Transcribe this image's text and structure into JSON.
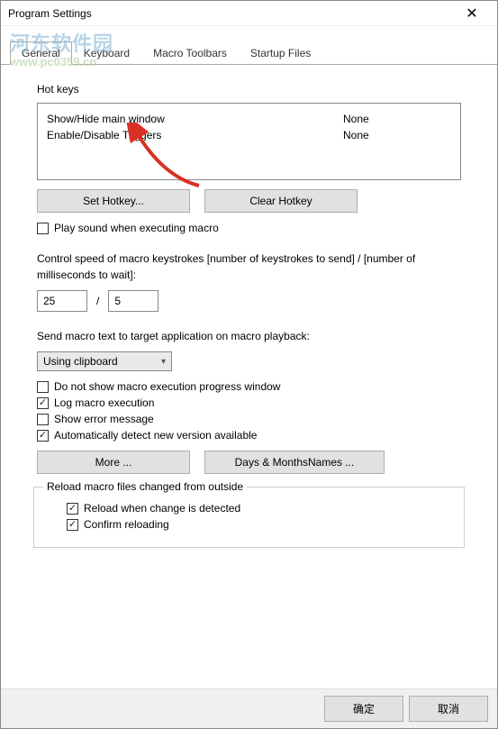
{
  "window": {
    "title": "Program Settings"
  },
  "watermark": {
    "main": "河东软件园",
    "sub": "www.pc0359.cn"
  },
  "tabs": [
    {
      "label": "General",
      "active": true
    },
    {
      "label": "Keyboard",
      "active": false
    },
    {
      "label": "Macro Toolbars",
      "active": false
    },
    {
      "label": "Startup Files",
      "active": false
    }
  ],
  "hotkeys": {
    "heading": "Hot keys",
    "rows": [
      {
        "name": "Show/Hide main window",
        "value": "None"
      },
      {
        "name": "Enable/Disable Triggers",
        "value": "None"
      }
    ],
    "set_btn": "Set Hotkey...",
    "clear_btn": "Clear Hotkey"
  },
  "play_sound": {
    "label": "Play sound when executing macro",
    "checked": false
  },
  "speed": {
    "description": "Control speed of macro keystrokes [number of keystrokes to send] / [number of milliseconds to wait]:",
    "keystrokes": "25",
    "sep": "/",
    "millis": "5"
  },
  "send_text": {
    "description": "Send macro text to target application on macro playback:",
    "selected": "Using clipboard"
  },
  "options": [
    {
      "label": "Do not show macro execution progress window",
      "checked": false
    },
    {
      "label": "Log macro execution",
      "checked": true
    },
    {
      "label": "Show error message",
      "checked": false
    },
    {
      "label": "Automatically detect new version available",
      "checked": true
    }
  ],
  "more_btn": "More ...",
  "days_btn": "Days & MonthsNames ...",
  "reload_group": {
    "legend": "Reload macro files changed from outside",
    "items": [
      {
        "label": "Reload when change is detected",
        "checked": true
      },
      {
        "label": "Confirm reloading",
        "checked": true
      }
    ]
  },
  "footer": {
    "ok": "确定",
    "cancel": "取消"
  }
}
